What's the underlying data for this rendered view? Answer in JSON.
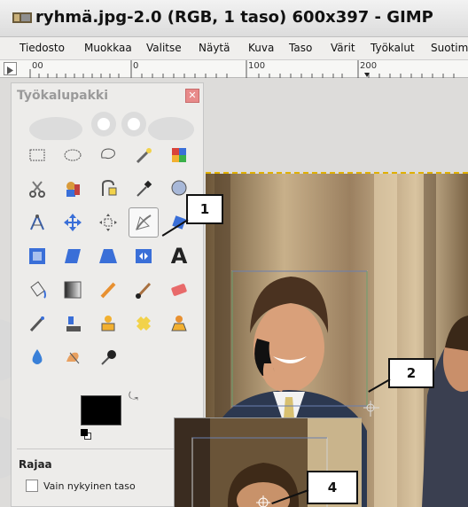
{
  "window": {
    "title": "ryhmä.jpg-2.0 (RGB, 1 taso) 600x397 - GIMP"
  },
  "menu": [
    "Tiedosto",
    "Muokkaa",
    "Valitse",
    "Näytä",
    "Kuva",
    "Taso",
    "Värit",
    "Työkalut",
    "Suotim"
  ],
  "ruler": {
    "labels": [
      "00",
      "0",
      "100",
      "200"
    ]
  },
  "toolbox": {
    "title": "Työkalupakki",
    "tools": [
      [
        "rect-select-icon",
        "ellipse-select-icon",
        "free-select-icon",
        "fuzzy-select-icon",
        "select-by-color-icon"
      ],
      [
        "scissors-icon",
        "foreground-select-icon",
        "paths-icon",
        "color-picker-icon",
        "zoom-icon"
      ],
      [
        "measure-icon",
        "move-icon",
        "align-icon",
        "crop-icon",
        "rotate-icon"
      ],
      [
        "scale-icon",
        "shear-icon",
        "perspective-icon",
        "flip-icon",
        "text-icon"
      ],
      [
        "bucket-fill-icon",
        "blend-icon",
        "pencil-icon",
        "paintbrush-icon",
        "eraser-icon"
      ],
      [
        "airbrush-icon",
        "ink-icon",
        "clone-icon",
        "heal-icon",
        "perspective-clone-icon"
      ],
      [
        "blur-icon",
        "smudge-icon",
        "dodge-burn-icon"
      ]
    ],
    "active_tool": "crop-icon",
    "options_title": "Rajaa",
    "option_checkbox_label": "Vain nykyinen taso",
    "foreground_color": "#000000",
    "background_color": "#ffffff"
  },
  "callouts": [
    "1",
    "2",
    "4"
  ],
  "colors": {
    "selection": "#e0b000",
    "accent": "#e88a8a"
  }
}
